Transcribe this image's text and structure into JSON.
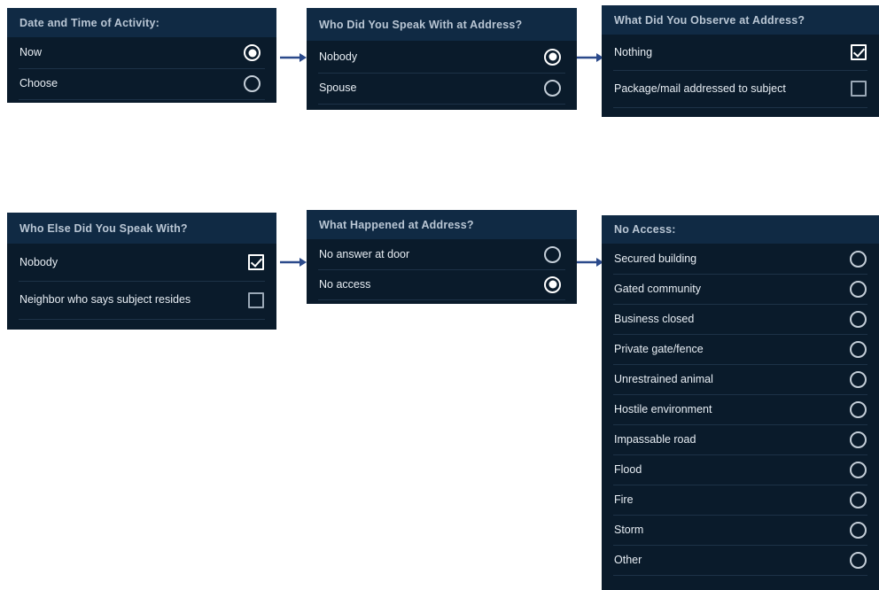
{
  "theme": {
    "page_background": "#ffffff",
    "card_background": "#0a1b2b",
    "card_header_background": "#102a44",
    "header_text_color": "#b9c6d4",
    "label_text_color": "#e8eef4",
    "divider_color": "#1d3247",
    "control_color": "#ffffff",
    "arrow_color": "#2b4a8b"
  },
  "cards": [
    {
      "id": "date-and-time-of-activity",
      "title": "Date and Time of Activity:",
      "control_type": "radio",
      "options": [
        {
          "label": "Now",
          "checked": true
        },
        {
          "label": "Choose",
          "checked": false
        }
      ]
    },
    {
      "id": "who-did-you-speak-with-at-address",
      "title": "Who Did You Speak With at Address?",
      "control_type": "radio",
      "options": [
        {
          "label": "Nobody",
          "checked": true
        },
        {
          "label": "Spouse",
          "checked": false
        }
      ]
    },
    {
      "id": "what-did-you-observe-at-address",
      "title": "What Did You Observe at Address?",
      "control_type": "checkbox",
      "options": [
        {
          "label": "Nothing",
          "checked": true
        },
        {
          "label": "Package/mail addressed to subject",
          "checked": false
        }
      ]
    },
    {
      "id": "who-else-did-you-speak-with",
      "title": "Who Else Did You Speak With?",
      "control_type": "checkbox",
      "options": [
        {
          "label": "Nobody",
          "checked": true
        },
        {
          "label": "Neighbor who says subject resides",
          "checked": false
        }
      ]
    },
    {
      "id": "what-happened-at-address",
      "title": "What Happened at Address?",
      "control_type": "radio",
      "options": [
        {
          "label": "No answer at door",
          "checked": false
        },
        {
          "label": "No access",
          "checked": true
        }
      ]
    },
    {
      "id": "no-access",
      "title": "No Access:",
      "control_type": "radio",
      "options": [
        {
          "label": "Secured building",
          "checked": false
        },
        {
          "label": "Gated community",
          "checked": false
        },
        {
          "label": "Business closed",
          "checked": false
        },
        {
          "label": "Private gate/fence",
          "checked": false
        },
        {
          "label": "Unrestrained animal",
          "checked": false
        },
        {
          "label": "Hostile environment",
          "checked": false
        },
        {
          "label": "Impassable road",
          "checked": false
        },
        {
          "label": "Flood",
          "checked": false
        },
        {
          "label": "Fire",
          "checked": false
        },
        {
          "label": "Storm",
          "checked": false
        },
        {
          "label": "Other",
          "checked": false
        }
      ]
    }
  ],
  "arrows": [
    {
      "id": "arrow-row1-card1-to-card2",
      "from": "date-and-time-of-activity",
      "to": "who-did-you-speak-with-at-address"
    },
    {
      "id": "arrow-row1-card2-to-card3",
      "from": "who-did-you-speak-with-at-address",
      "to": "what-did-you-observe-at-address"
    },
    {
      "id": "arrow-row2-card1-to-card2",
      "from": "who-else-did-you-speak-with",
      "to": "what-happened-at-address"
    },
    {
      "id": "arrow-row2-card2-to-card3",
      "from": "what-happened-at-address",
      "to": "no-access"
    }
  ]
}
